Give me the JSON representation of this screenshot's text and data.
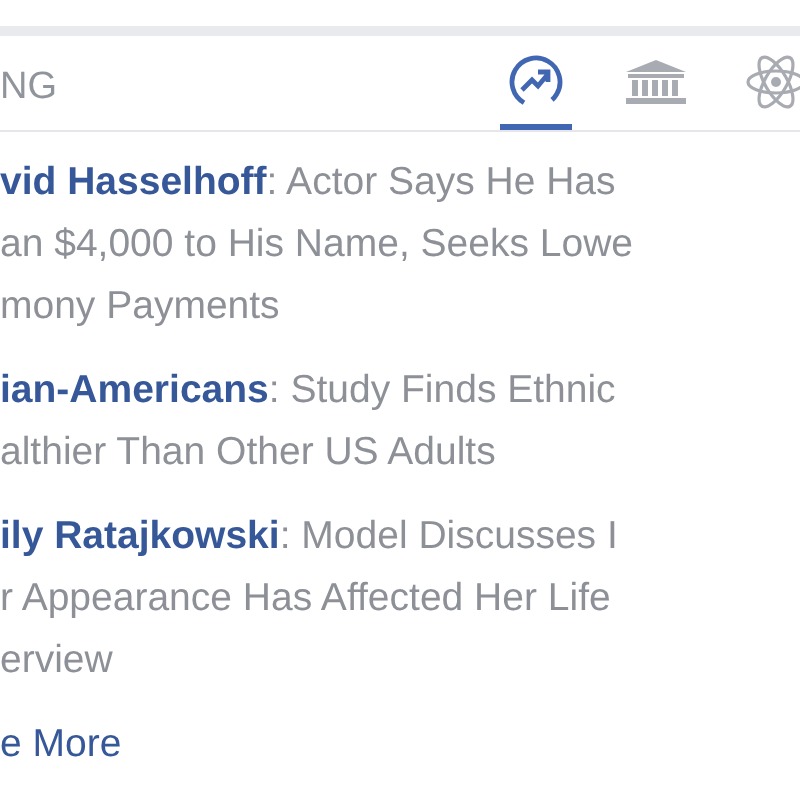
{
  "header": {
    "title": "NG"
  },
  "tabs": [
    {
      "kind": "trending",
      "selected": true
    },
    {
      "kind": "politics",
      "selected": false
    },
    {
      "kind": "science",
      "selected": false
    }
  ],
  "stories": [
    {
      "topic": "vid Hasselhoff",
      "lines": [
        ": Actor Says He Has",
        "an $4,000 to His Name, Seeks Lowe",
        "mony Payments"
      ]
    },
    {
      "topic": "ian-Americans",
      "lines": [
        ": Study Finds Ethnic",
        "althier Than Other US Adults"
      ]
    },
    {
      "topic": "ily Ratajkowski",
      "lines": [
        ": Model Discusses I",
        "r Appearance Has Affected Her Life",
        "erview"
      ]
    }
  ],
  "see_more": "e More"
}
